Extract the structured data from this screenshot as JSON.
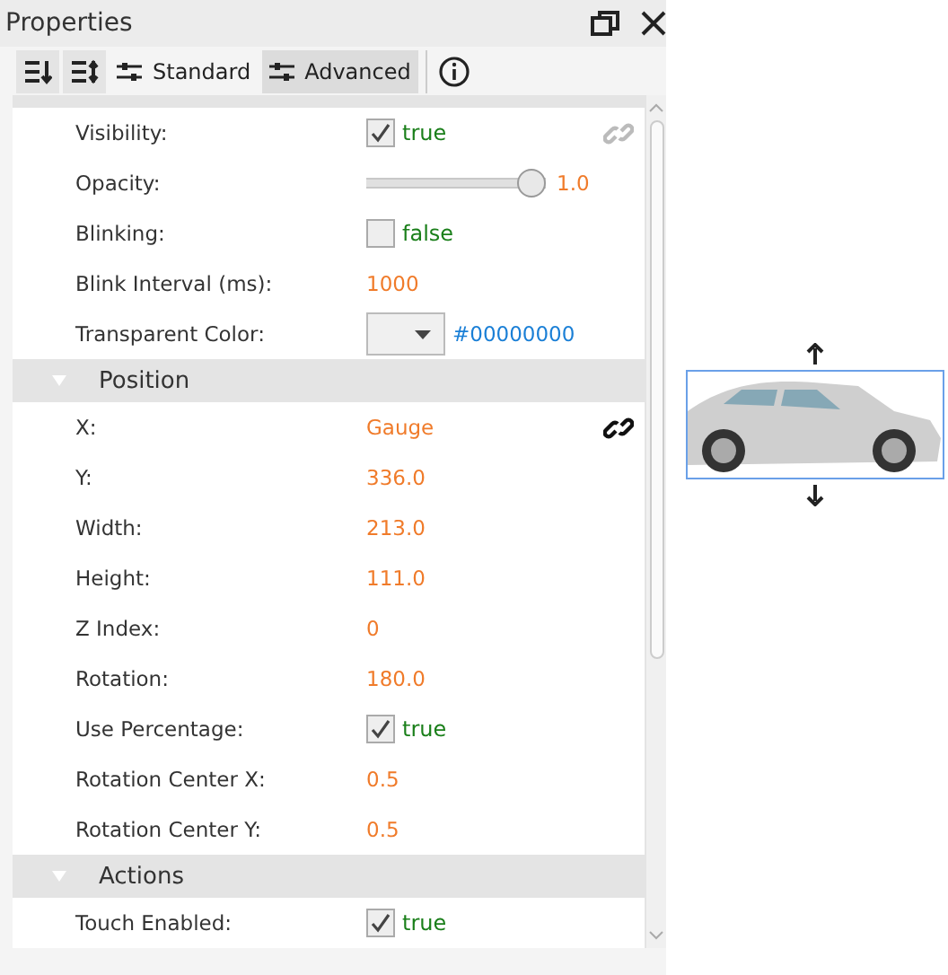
{
  "panel": {
    "title": "Properties"
  },
  "toolbar": [
    {
      "kind": "sort-asc"
    },
    {
      "kind": "sort-desc"
    },
    {
      "kind": "mode",
      "label": "Standard",
      "selected": false
    },
    {
      "kind": "mode",
      "label": "Advanced",
      "selected": true
    },
    {
      "kind": "info"
    }
  ],
  "sections": [
    {
      "expanded": true,
      "rows": [
        {
          "label": "Visibility:",
          "kind": "check",
          "checked": true,
          "value": "true",
          "linked": false
        },
        {
          "label": "Opacity:",
          "kind": "slider",
          "level": 1.0,
          "value": "1.0"
        },
        {
          "label": "Blinking:",
          "kind": "check",
          "checked": false,
          "value": "false"
        },
        {
          "label": "Blink Interval (ms):",
          "kind": "text",
          "value": "1000"
        },
        {
          "label": "Transparent Color:",
          "kind": "color",
          "value": "#00000000"
        }
      ]
    },
    {
      "title": "Position",
      "expanded": true,
      "rows": [
        {
          "label": "X:",
          "kind": "text",
          "value": "Gauge",
          "linked": true
        },
        {
          "label": "Y:",
          "kind": "text",
          "value": "336.0"
        },
        {
          "label": "Width:",
          "kind": "text",
          "value": "213.0"
        },
        {
          "label": "Height:",
          "kind": "text",
          "value": "111.0"
        },
        {
          "label": "Z Index:",
          "kind": "text",
          "value": "0"
        },
        {
          "label": "Rotation:",
          "kind": "text",
          "value": "180.0"
        },
        {
          "label": "Use Percentage:",
          "kind": "check",
          "checked": true,
          "value": "true"
        },
        {
          "label": "Rotation Center X:",
          "kind": "text",
          "value": "0.5"
        },
        {
          "label": "Rotation Center Y:",
          "kind": "text",
          "value": "0.5"
        }
      ]
    },
    {
      "title": "Actions",
      "expanded": true,
      "rows": [
        {
          "label": "Touch Enabled:",
          "kind": "check",
          "checked": true,
          "value": "true"
        }
      ]
    }
  ]
}
